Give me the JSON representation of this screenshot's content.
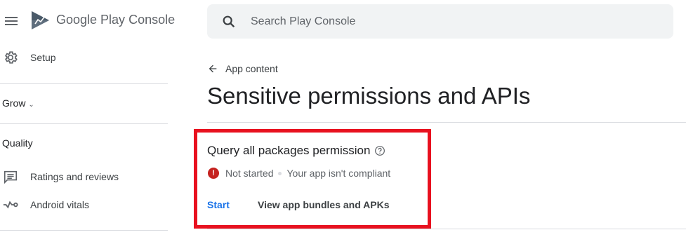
{
  "app": {
    "brand_primary": "Google Play",
    "brand_secondary": "Console"
  },
  "search": {
    "placeholder": "Search Play Console"
  },
  "sidebar": {
    "setup_label": "Setup",
    "grow_label": "Grow",
    "quality_label": "Quality",
    "items": [
      {
        "label": "Ratings and reviews",
        "icon": "comment-list-icon"
      },
      {
        "label": "Android vitals",
        "icon": "vitals-pulse-icon"
      }
    ]
  },
  "main": {
    "back_label": "App content",
    "title": "Sensitive permissions and APIs",
    "card": {
      "title": "Query all packages permission",
      "status": "Not started",
      "compliance": "Your app isn't compliant",
      "start_label": "Start",
      "view_label": "View app bundles and APKs"
    }
  },
  "colors": {
    "accent": "#1a73e8",
    "error": "#c5221f",
    "highlight": "#e8111f",
    "search_bg": "#f1f3f4"
  }
}
